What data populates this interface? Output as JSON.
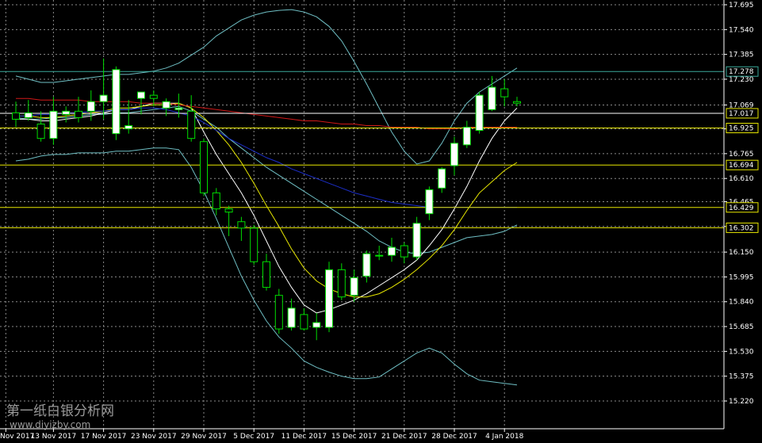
{
  "chart_data": {
    "type": "candlestick",
    "y_ticks": [
      15.22,
      15.375,
      15.53,
      15.685,
      15.84,
      15.995,
      16.15,
      16.31,
      16.465,
      16.61,
      16.765,
      16.92,
      17.069,
      17.23,
      17.385,
      17.54,
      17.695
    ],
    "y_tick_labels": [
      "15.220",
      "15.375",
      "15.530",
      "15.685",
      "15.840",
      "15.995",
      "16.150",
      "16.310",
      "16.465",
      "16.610",
      "16.765",
      "16.920",
      "17.069",
      "17.230",
      "17.385",
      "17.540",
      "17.695"
    ],
    "ylim": [
      15.19,
      17.71
    ],
    "x_labels": [
      {
        "index": -0.8,
        "label": "Nov 2017"
      },
      {
        "index": 3,
        "label": "13 Nov 2017"
      },
      {
        "index": 7,
        "label": "17 Nov 2017"
      },
      {
        "index": 11,
        "label": "23 Nov 2017"
      },
      {
        "index": 15,
        "label": "29 Nov 2017"
      },
      {
        "index": 19,
        "label": "5 Dec 2017"
      },
      {
        "index": 23,
        "label": "11 Dec 2017"
      },
      {
        "index": 27,
        "label": "15 Dec 2017"
      },
      {
        "index": 31,
        "label": "21 Dec 2017"
      },
      {
        "index": 35,
        "label": "28 Dec 2017"
      },
      {
        "index": 39,
        "label": "4 Jan 2018"
      }
    ],
    "candles": [
      {
        "o": 17.02,
        "h": 17.09,
        "l": 16.93,
        "c": 16.98
      },
      {
        "o": 16.99,
        "h": 17.1,
        "l": 16.97,
        "c": 17.02
      },
      {
        "o": 16.95,
        "h": 17.03,
        "l": 16.84,
        "c": 16.86
      },
      {
        "o": 16.86,
        "h": 17.12,
        "l": 16.82,
        "c": 17.03
      },
      {
        "o": 17.01,
        "h": 17.06,
        "l": 16.96,
        "c": 17.03
      },
      {
        "o": 17.03,
        "h": 17.12,
        "l": 16.96,
        "c": 16.99
      },
      {
        "o": 17.03,
        "h": 17.16,
        "l": 16.97,
        "c": 17.09
      },
      {
        "o": 17.09,
        "h": 17.36,
        "l": 16.98,
        "c": 17.13
      },
      {
        "o": 16.89,
        "h": 17.31,
        "l": 16.85,
        "c": 17.29
      },
      {
        "o": 16.92,
        "h": 17.1,
        "l": 16.89,
        "c": 16.94
      },
      {
        "o": 17.11,
        "h": 17.14,
        "l": 17.01,
        "c": 17.15
      },
      {
        "o": 17.13,
        "h": 17.16,
        "l": 17.06,
        "c": 17.11
      },
      {
        "o": 17.05,
        "h": 17.11,
        "l": 17.0,
        "c": 17.09
      },
      {
        "o": 17.04,
        "h": 17.14,
        "l": 16.99,
        "c": 17.05
      },
      {
        "o": 17.03,
        "h": 17.13,
        "l": 16.84,
        "c": 16.86
      },
      {
        "o": 16.84,
        "h": 16.86,
        "l": 16.5,
        "c": 16.52
      },
      {
        "o": 16.52,
        "h": 16.55,
        "l": 16.38,
        "c": 16.42
      },
      {
        "o": 16.42,
        "h": 16.44,
        "l": 16.25,
        "c": 16.4
      },
      {
        "o": 16.34,
        "h": 16.37,
        "l": 16.22,
        "c": 16.3
      },
      {
        "o": 16.3,
        "h": 16.32,
        "l": 16.07,
        "c": 16.09
      },
      {
        "o": 16.09,
        "h": 16.14,
        "l": 15.91,
        "c": 15.93
      },
      {
        "o": 15.88,
        "h": 15.92,
        "l": 15.64,
        "c": 15.67
      },
      {
        "o": 15.68,
        "h": 15.86,
        "l": 15.66,
        "c": 15.8
      },
      {
        "o": 15.76,
        "h": 15.8,
        "l": 15.66,
        "c": 15.67
      },
      {
        "o": 15.68,
        "h": 15.77,
        "l": 15.6,
        "c": 15.71
      },
      {
        "o": 15.68,
        "h": 16.09,
        "l": 15.65,
        "c": 16.04
      },
      {
        "o": 16.04,
        "h": 16.08,
        "l": 15.85,
        "c": 15.87
      },
      {
        "o": 15.88,
        "h": 16.04,
        "l": 15.84,
        "c": 15.99
      },
      {
        "o": 16.0,
        "h": 16.16,
        "l": 15.96,
        "c": 16.14
      },
      {
        "o": 16.13,
        "h": 16.19,
        "l": 16.1,
        "c": 16.13
      },
      {
        "o": 16.13,
        "h": 16.24,
        "l": 16.09,
        "c": 16.18
      },
      {
        "o": 16.19,
        "h": 16.21,
        "l": 16.08,
        "c": 16.12
      },
      {
        "o": 16.12,
        "h": 16.37,
        "l": 16.1,
        "c": 16.33
      },
      {
        "o": 16.39,
        "h": 16.56,
        "l": 16.35,
        "c": 16.54
      },
      {
        "o": 16.55,
        "h": 16.68,
        "l": 16.52,
        "c": 16.67
      },
      {
        "o": 16.69,
        "h": 16.87,
        "l": 16.63,
        "c": 16.83
      },
      {
        "o": 16.82,
        "h": 16.97,
        "l": 16.8,
        "c": 16.93
      },
      {
        "o": 16.91,
        "h": 17.15,
        "l": 16.89,
        "c": 17.13
      },
      {
        "o": 17.04,
        "h": 17.25,
        "l": 17.03,
        "c": 17.18
      },
      {
        "o": 17.17,
        "h": 17.23,
        "l": 17.06,
        "c": 17.12
      },
      {
        "o": 17.09,
        "h": 17.12,
        "l": 17.06,
        "c": 17.08
      }
    ],
    "overlays": [
      {
        "color": "#6fbfc4",
        "role": "bollinger-upper",
        "values": [
          17.25,
          17.23,
          17.21,
          17.21,
          17.22,
          17.23,
          17.24,
          17.25,
          17.26,
          17.26,
          17.27,
          17.28,
          17.3,
          17.33,
          17.38,
          17.43,
          17.5,
          17.55,
          17.6,
          17.63,
          17.65,
          17.66,
          17.665,
          17.65,
          17.62,
          17.56,
          17.47,
          17.34,
          17.2,
          17.05,
          16.9,
          16.78,
          16.7,
          16.72,
          16.83,
          16.97,
          17.08,
          17.15,
          17.2,
          17.25,
          17.3
        ]
      },
      {
        "color": "#6fbfc4",
        "role": "bollinger-lower",
        "values": [
          16.72,
          16.73,
          16.75,
          16.76,
          16.76,
          16.77,
          16.77,
          16.77,
          16.78,
          16.78,
          16.79,
          16.8,
          16.8,
          16.79,
          16.68,
          16.53,
          16.36,
          16.18,
          16.0,
          15.85,
          15.72,
          15.62,
          15.55,
          15.47,
          15.43,
          15.4,
          15.375,
          15.36,
          15.36,
          15.37,
          15.42,
          15.47,
          15.52,
          15.55,
          15.52,
          15.45,
          15.39,
          15.35,
          15.34,
          15.33,
          15.32
        ]
      },
      {
        "color": "#6fbfc4",
        "role": "bollinger-mid",
        "values": [
          16.99,
          16.98,
          16.98,
          16.99,
          16.99,
          17.0,
          17.01,
          17.01,
          17.02,
          17.02,
          17.03,
          17.04,
          17.05,
          17.06,
          17.03,
          16.98,
          16.93,
          16.86,
          16.8,
          16.74,
          16.68,
          16.63,
          16.58,
          16.53,
          16.48,
          16.43,
          16.38,
          16.33,
          16.28,
          16.22,
          16.18,
          16.15,
          16.14,
          16.15,
          16.18,
          16.21,
          16.24,
          16.25,
          16.26,
          16.28,
          16.32
        ]
      },
      {
        "color": "#ffffff",
        "role": "moving-average-fast",
        "values": [
          16.98,
          16.98,
          16.97,
          16.97,
          16.98,
          16.99,
          17.0,
          17.02,
          17.04,
          17.04,
          17.06,
          17.08,
          17.08,
          17.08,
          17.05,
          16.9,
          16.76,
          16.64,
          16.52,
          16.38,
          16.22,
          16.06,
          15.93,
          15.82,
          15.77,
          15.79,
          15.82,
          15.85,
          15.89,
          15.94,
          15.99,
          16.04,
          16.1,
          16.19,
          16.29,
          16.42,
          16.56,
          16.72,
          16.86,
          16.97,
          17.05
        ]
      },
      {
        "color": "#e8e800",
        "role": "moving-average-slow",
        "values": [
          17.0,
          17.0,
          16.99,
          16.99,
          17.0,
          17.01,
          17.02,
          17.03,
          17.05,
          17.05,
          17.06,
          17.07,
          17.07,
          17.08,
          17.05,
          16.99,
          16.91,
          16.82,
          16.71,
          16.58,
          16.44,
          16.31,
          16.17,
          16.05,
          15.97,
          15.92,
          15.89,
          15.87,
          15.87,
          15.89,
          15.93,
          15.98,
          16.04,
          16.11,
          16.19,
          16.29,
          16.41,
          16.52,
          16.59,
          16.66,
          16.71
        ]
      },
      {
        "color": "#d01818",
        "role": "moving-average-long",
        "values": [
          17.11,
          17.11,
          17.1,
          17.1,
          17.1,
          17.1,
          17.09,
          17.09,
          17.09,
          17.09,
          17.08,
          17.08,
          17.08,
          17.07,
          17.06,
          17.05,
          17.04,
          17.03,
          17.02,
          17.01,
          17.0,
          16.99,
          16.98,
          16.97,
          16.97,
          16.96,
          16.95,
          16.95,
          16.94,
          16.94,
          16.93,
          16.93,
          16.93,
          16.92,
          16.92,
          16.92,
          16.93,
          16.93,
          16.93,
          16.93,
          16.93
        ]
      },
      {
        "color": "#1c2ec8",
        "role": "moving-average-blue",
        "values": [
          17.0,
          17.0,
          17.01,
          17.01,
          17.02,
          17.02,
          17.03,
          17.03,
          17.04,
          17.04,
          17.05,
          17.05,
          17.04,
          17.02,
          17.0,
          16.96,
          16.91,
          16.86,
          16.82,
          16.78,
          16.74,
          16.71,
          16.67,
          16.64,
          16.61,
          16.58,
          16.55,
          16.52,
          16.5,
          16.48,
          16.46,
          16.45,
          16.44,
          16.43,
          16.43,
          16.43,
          16.43,
          16.43,
          16.43,
          16.43,
          16.43
        ]
      }
    ],
    "h_lines": [
      {
        "value": 17.278,
        "label": "17.278",
        "color": "#3aa89a",
        "label_bg": "#3aa89a"
      },
      {
        "value": 17.017,
        "label": "17.017",
        "color": "#ffffff",
        "label_bg": "#e6e600"
      },
      {
        "value": 16.925,
        "label": "16.925",
        "color": "#e6e600",
        "label_bg": "#e6e600"
      },
      {
        "value": 16.694,
        "label": "16.694",
        "color": "#e6e600",
        "label_bg": "#e6e600"
      },
      {
        "value": 16.429,
        "label": "16.429",
        "color": "#e6e600",
        "label_bg": "#e6e600"
      },
      {
        "value": 16.302,
        "label": "16.302",
        "color": "#e6e600",
        "label_bg": "#e6e600"
      }
    ],
    "colors": {
      "background": "#000000",
      "grid": "#8a8a8a",
      "bull_body": "#ffffff",
      "bear_body": "#000000",
      "bull_wick": "#00dd00",
      "bear_wick": "#00dd00",
      "axis_text": "#ffffff"
    }
  },
  "watermark": {
    "title": "第一纸白银分析网",
    "url": "www.diyizby.com"
  }
}
